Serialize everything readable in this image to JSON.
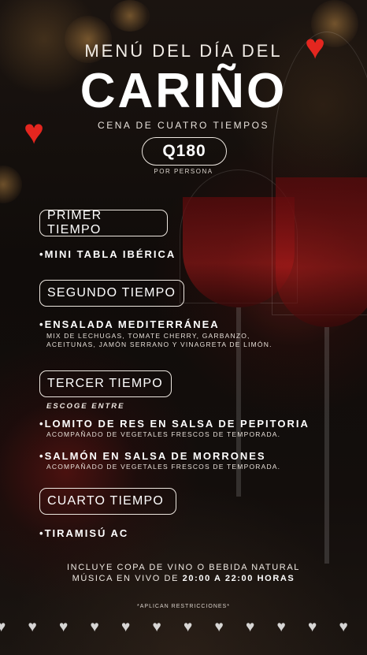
{
  "header": {
    "title_top": "MENÚ DEL DÍA DEL",
    "title_main": "CARIÑO",
    "subtitle": "CENA DE CUATRO TIEMPOS",
    "price": "Q180",
    "price_note": "POR PERSONA"
  },
  "courses": [
    {
      "label": "PRIMER TIEMPO",
      "dishes": [
        {
          "name": "MINI TABLA IBÉRICA"
        }
      ]
    },
    {
      "label": "SEGUNDO TIEMPO",
      "dishes": [
        {
          "name": "ENSALADA MEDITERRÁNEA",
          "desc_line1": "MIX DE LECHUGAS, TOMATE CHERRY, GARBANZO,",
          "desc_line2": "ACEITUNAS, JAMÓN SERRANO Y VINAGRETA DE LIMÓN."
        }
      ]
    },
    {
      "label": "TERCER TIEMPO",
      "choose": "ESCOGE ENTRE",
      "dishes": [
        {
          "name": "LOMITO DE RES EN SALSA DE PEPITORIA",
          "desc": "ACOMPAÑADO DE VEGETALES FRESCOS DE TEMPORADA."
        },
        {
          "name": "SALMÓN EN SALSA DE MORRONES",
          "desc": "ACOMPAÑADO DE VEGETALES FRESCOS DE TEMPORADA."
        }
      ]
    },
    {
      "label": "CUARTO TIEMPO",
      "dishes": [
        {
          "name": "TIRAMISÚ AC"
        }
      ]
    }
  ],
  "footer": {
    "line1": "INCLUYE COPA DE VINO O BEBIDA NATURAL",
    "line2_prefix": "MÚSICA EN VIVO DE",
    "line2_time": "20:00 A 22:00 HORAS",
    "restrictions": "*APLICAN RESTRICCIONES*"
  },
  "colors": {
    "accent_heart": "#e4261f",
    "text": "#ffffff",
    "background": "#100c0a"
  },
  "icons": {
    "bullet": "•",
    "heart_glyph": "♥",
    "decorative_heart": "heart-icon",
    "footer_hearts_count": 12
  }
}
